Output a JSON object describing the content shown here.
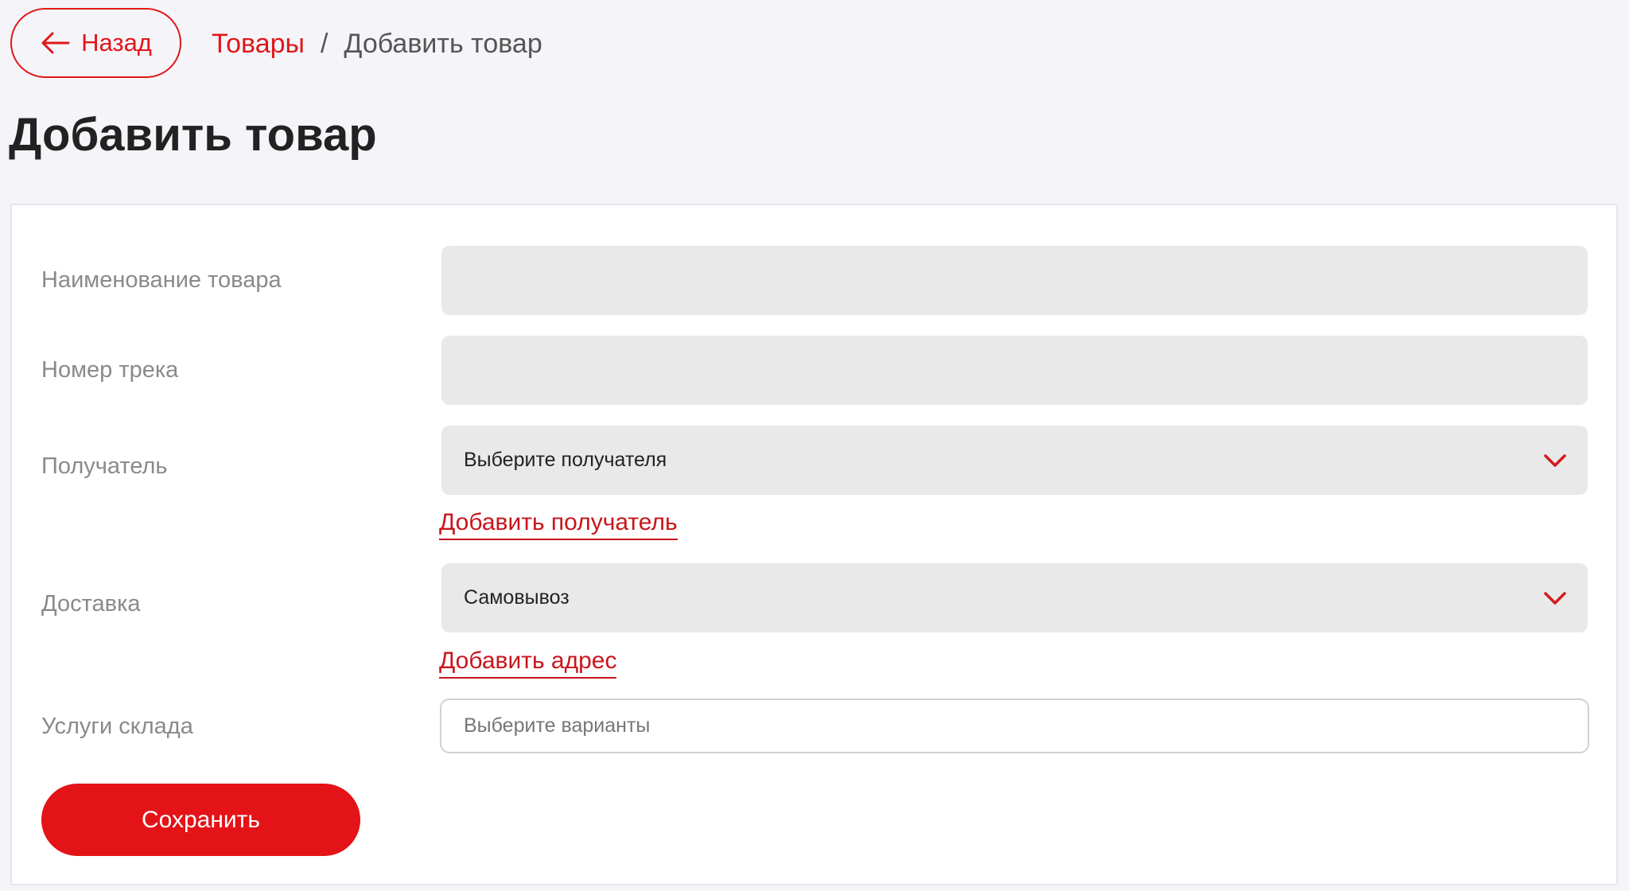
{
  "header": {
    "back_label": "Назад",
    "breadcrumb": {
      "parent": "Товары",
      "separator": "/",
      "current": "Добавить товар"
    },
    "title": "Добавить товар"
  },
  "form": {
    "product_name": {
      "label": "Наименование товара",
      "value": ""
    },
    "track_number": {
      "label": "Номер трека",
      "value": ""
    },
    "recipient": {
      "label": "Получатель",
      "selected": "Выберите получателя",
      "add_link": "Добавить получатель"
    },
    "delivery": {
      "label": "Доставка",
      "selected": "Самовывоз",
      "add_link": "Добавить адрес"
    },
    "warehouse_services": {
      "label": "Услуги склада",
      "placeholder": "Выберите варианты"
    },
    "save_label": "Сохранить"
  },
  "colors": {
    "accent": "#e31318",
    "page_bg": "#f5f5f9",
    "field_bg": "#e9e9e9"
  },
  "icons": {
    "back": "arrow-left-icon",
    "dropdown": "chevron-down-icon"
  }
}
